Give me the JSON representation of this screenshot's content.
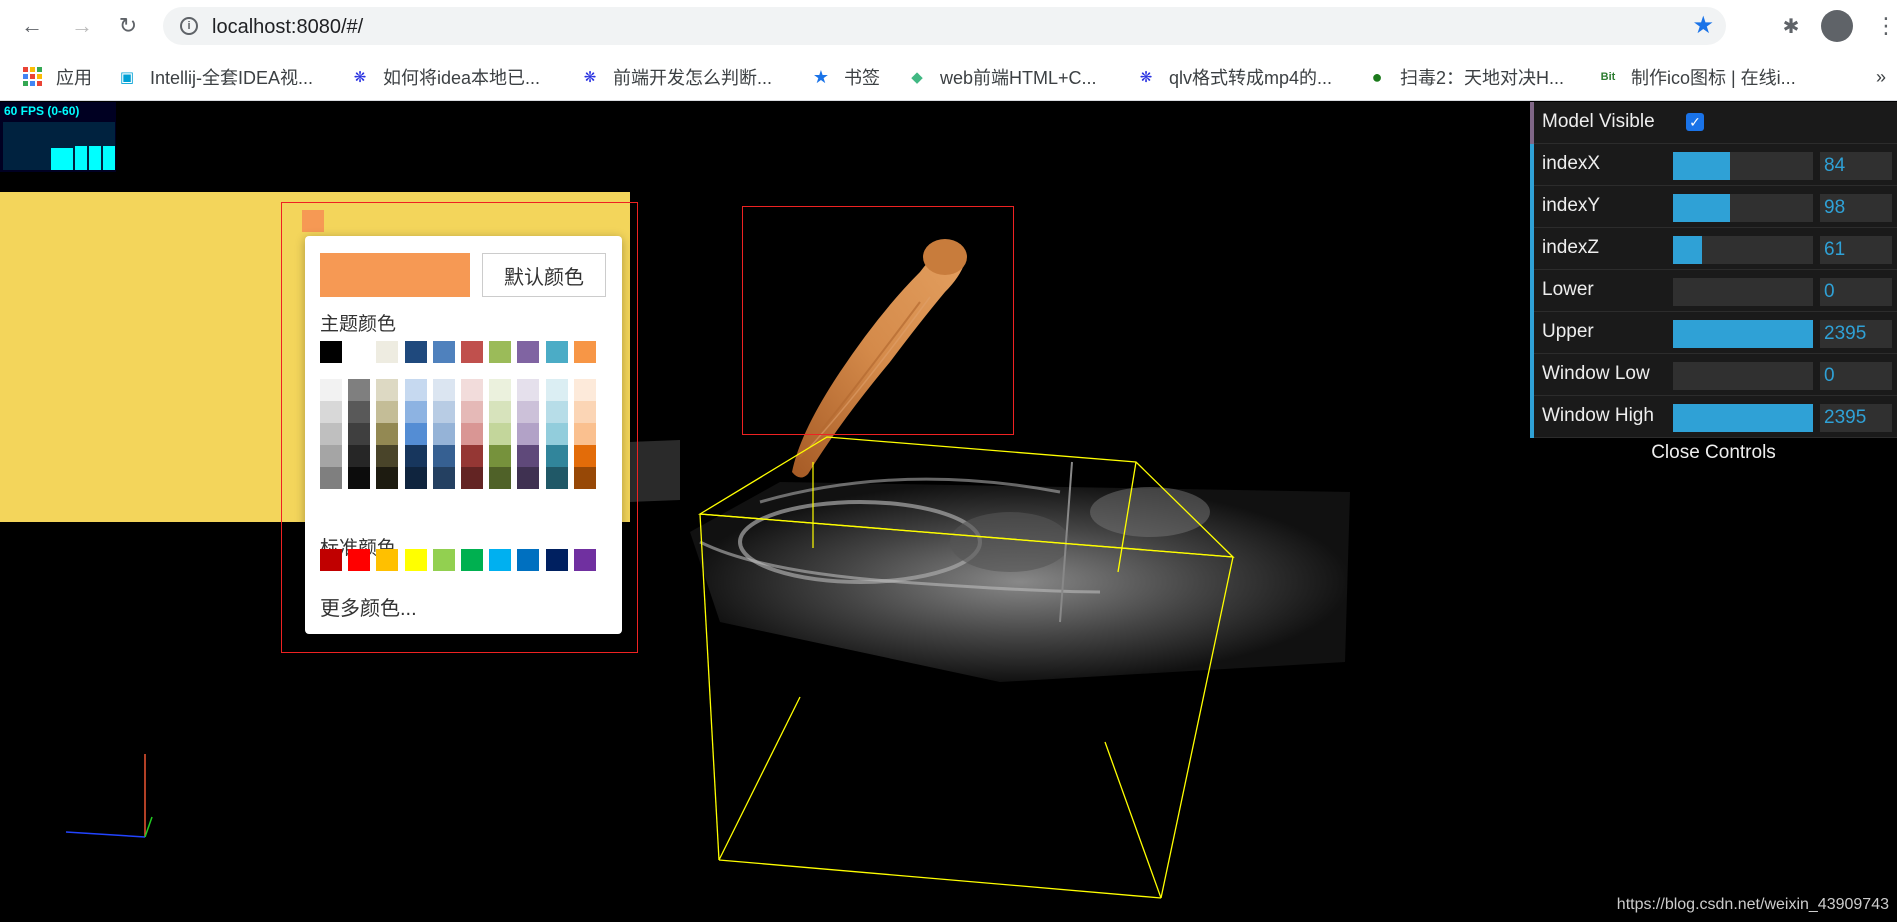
{
  "browser": {
    "url": "localhost:8080/#/",
    "bookmarks": [
      {
        "label": "应用",
        "icon": "apps-grid-icon"
      },
      {
        "label": "Intellij-全套IDEA视...",
        "icon": "bilibili-icon"
      },
      {
        "label": "如何将idea本地已...",
        "icon": "baidu-paw-icon"
      },
      {
        "label": "前端开发怎么判断...",
        "icon": "baidu-paw-icon"
      },
      {
        "label": "书签",
        "icon": "star-icon"
      },
      {
        "label": "web前端HTML+C...",
        "icon": "vue-icon"
      },
      {
        "label": "qlv格式转成mp4的...",
        "icon": "baidu-paw-icon"
      },
      {
        "label": "扫毒2：天地对决H...",
        "icon": "globe-icon"
      },
      {
        "label": "制作ico图标 | 在线i...",
        "icon": "bit-icon"
      }
    ]
  },
  "fps": {
    "label": "60 FPS (0-60)"
  },
  "color_picker": {
    "current_color": "#f69954",
    "default_button": "默认颜色",
    "theme_label": "主题颜色",
    "standard_label": "标准颜色",
    "more_label": "更多颜色...",
    "theme_top": [
      "#000000",
      "#ffffff",
      "#eeece1",
      "#1f497d",
      "#4f81bd",
      "#c0504d",
      "#9bbb59",
      "#8064a2",
      "#4bacc6",
      "#f79646"
    ],
    "theme_columns": [
      [
        "#f2f2f2",
        "#d8d8d8",
        "#bfbfbf",
        "#a5a5a5",
        "#7f7f7f"
      ],
      [
        "#7f7f7f",
        "#595959",
        "#3f3f3f",
        "#262626",
        "#0c0c0c"
      ],
      [
        "#ddd9c3",
        "#c4bd97",
        "#938953",
        "#494429",
        "#1d1b10"
      ],
      [
        "#c6d9f0",
        "#8db3e2",
        "#548dd4",
        "#17365d",
        "#0f243e"
      ],
      [
        "#dbe5f1",
        "#b8cce4",
        "#95b3d7",
        "#366092",
        "#244061"
      ],
      [
        "#f2dcdb",
        "#e5b9b7",
        "#d99694",
        "#953734",
        "#632423"
      ],
      [
        "#ebf1dd",
        "#d7e3bc",
        "#c3d69b",
        "#76923c",
        "#4f6128"
      ],
      [
        "#e5e0ec",
        "#ccc1d9",
        "#b2a2c7",
        "#5f497a",
        "#3f3151"
      ],
      [
        "#dbeef3",
        "#b7dde8",
        "#92cddc",
        "#31859b",
        "#205867"
      ],
      [
        "#fdeada",
        "#fbd5b5",
        "#fac08f",
        "#e36c09",
        "#974806"
      ]
    ],
    "standard": [
      "#c00000",
      "#ff0000",
      "#ffc000",
      "#ffff00",
      "#92d050",
      "#00b050",
      "#00b0f0",
      "#0070c0",
      "#002060",
      "#7030a0"
    ]
  },
  "controls": {
    "model_visible_label": "Model Visible",
    "model_visible": true,
    "rows": [
      {
        "name": "indexX",
        "value": "84",
        "fraction": 0.41
      },
      {
        "name": "indexY",
        "value": "98",
        "fraction": 0.41
      },
      {
        "name": "indexZ",
        "value": "61",
        "fraction": 0.21
      },
      {
        "name": "Lower",
        "value": "0",
        "fraction": 0
      },
      {
        "name": "Upper",
        "value": "2395",
        "fraction": 1
      },
      {
        "name": "Window Low",
        "value": "0",
        "fraction": 0
      },
      {
        "name": "Window High",
        "value": "2395",
        "fraction": 1
      }
    ],
    "close_label": "Close Controls"
  },
  "watermark": "https://blog.csdn.net/weixin_43909743"
}
